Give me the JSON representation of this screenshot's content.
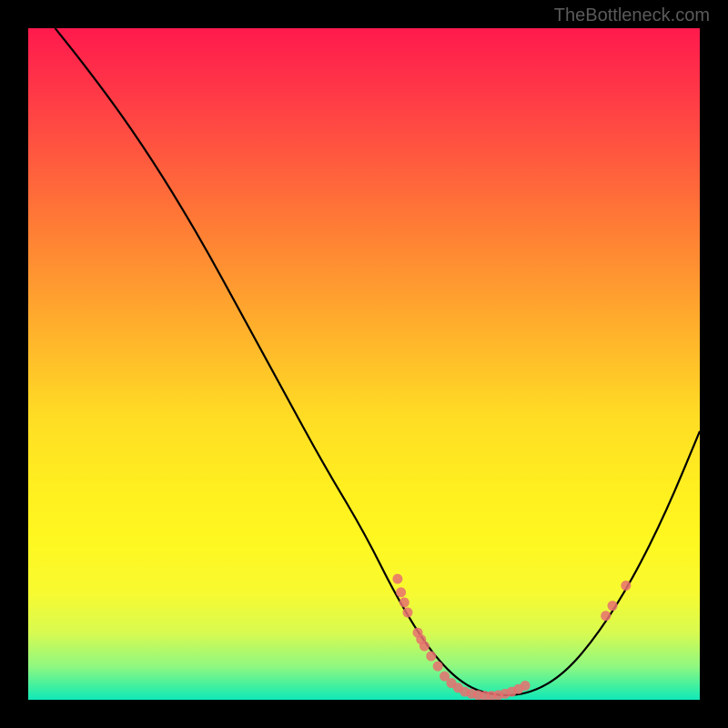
{
  "watermark": "TheBottleneck.com",
  "chart_data": {
    "type": "line",
    "title": "",
    "xlabel": "",
    "ylabel": "",
    "xlim": [
      0,
      100
    ],
    "ylim": [
      0,
      100
    ],
    "curve": [
      {
        "x": 4,
        "y": 100
      },
      {
        "x": 8,
        "y": 95
      },
      {
        "x": 14,
        "y": 87
      },
      {
        "x": 20,
        "y": 78
      },
      {
        "x": 26,
        "y": 68
      },
      {
        "x": 32,
        "y": 57
      },
      {
        "x": 38,
        "y": 46
      },
      {
        "x": 44,
        "y": 35
      },
      {
        "x": 50,
        "y": 25
      },
      {
        "x": 55,
        "y": 15
      },
      {
        "x": 60,
        "y": 7
      },
      {
        "x": 65,
        "y": 2
      },
      {
        "x": 70,
        "y": 0.5
      },
      {
        "x": 75,
        "y": 1
      },
      {
        "x": 80,
        "y": 4
      },
      {
        "x": 85,
        "y": 10
      },
      {
        "x": 90,
        "y": 18
      },
      {
        "x": 95,
        "y": 28
      },
      {
        "x": 100,
        "y": 40
      }
    ],
    "scatter_points": [
      {
        "x": 55,
        "y": 18
      },
      {
        "x": 55.5,
        "y": 16
      },
      {
        "x": 56,
        "y": 14.5
      },
      {
        "x": 56.5,
        "y": 13
      },
      {
        "x": 58,
        "y": 10
      },
      {
        "x": 58.5,
        "y": 9
      },
      {
        "x": 59,
        "y": 8
      },
      {
        "x": 60,
        "y": 6.5
      },
      {
        "x": 61,
        "y": 5
      },
      {
        "x": 62,
        "y": 3.5
      },
      {
        "x": 63,
        "y": 2.5
      },
      {
        "x": 64,
        "y": 1.8
      },
      {
        "x": 65,
        "y": 1.2
      },
      {
        "x": 66,
        "y": 0.9
      },
      {
        "x": 67,
        "y": 0.7
      },
      {
        "x": 68,
        "y": 0.6
      },
      {
        "x": 69,
        "y": 0.6
      },
      {
        "x": 70,
        "y": 0.7
      },
      {
        "x": 71,
        "y": 0.9
      },
      {
        "x": 72,
        "y": 1.2
      },
      {
        "x": 73,
        "y": 1.6
      },
      {
        "x": 74,
        "y": 2.1
      },
      {
        "x": 86,
        "y": 12.5
      },
      {
        "x": 87,
        "y": 14
      },
      {
        "x": 89,
        "y": 17
      }
    ],
    "gradient_colors": {
      "top": "#ff1a4d",
      "mid": "#ffdd24",
      "bottom": "#10e8b8"
    }
  }
}
